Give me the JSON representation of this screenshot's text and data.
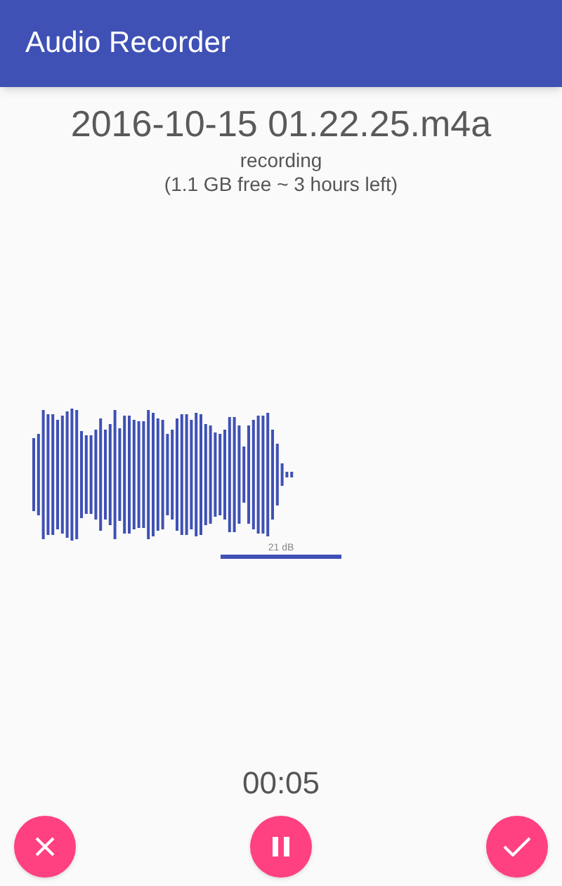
{
  "app_bar": {
    "title": "Audio Recorder"
  },
  "file_name": "2016-10-15 01.22.25.m4a",
  "status": "recording",
  "storage": "(1.1 GB free ~ 3 hours left)",
  "meter": {
    "reading": "21 dB"
  },
  "elapsed": "00:05"
}
